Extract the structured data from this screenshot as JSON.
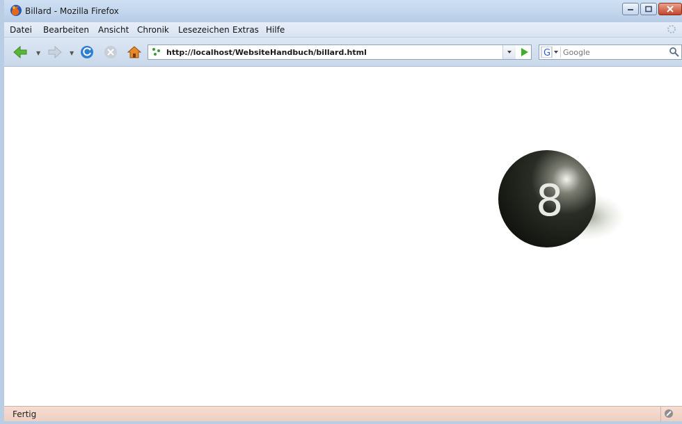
{
  "window": {
    "title": "Billard - Mozilla Firefox"
  },
  "menubar": {
    "items": [
      {
        "label": "Datei"
      },
      {
        "label": "Bearbeiten"
      },
      {
        "label": "Ansicht"
      },
      {
        "label": "Chronik"
      },
      {
        "label": "Lesezeichen"
      },
      {
        "label": "Extras"
      },
      {
        "label": "Hilfe"
      }
    ]
  },
  "navbar": {
    "url": "http://localhost/WebsiteHandbuch/billard.html",
    "search_placeholder": "Google"
  },
  "content": {
    "ball_number": "8"
  },
  "statusbar": {
    "text": "Fertig"
  },
  "colors": {
    "titlebar": "#c3d6ec",
    "statusbar": "#f2d6c9",
    "ball": "#1b1e18"
  }
}
